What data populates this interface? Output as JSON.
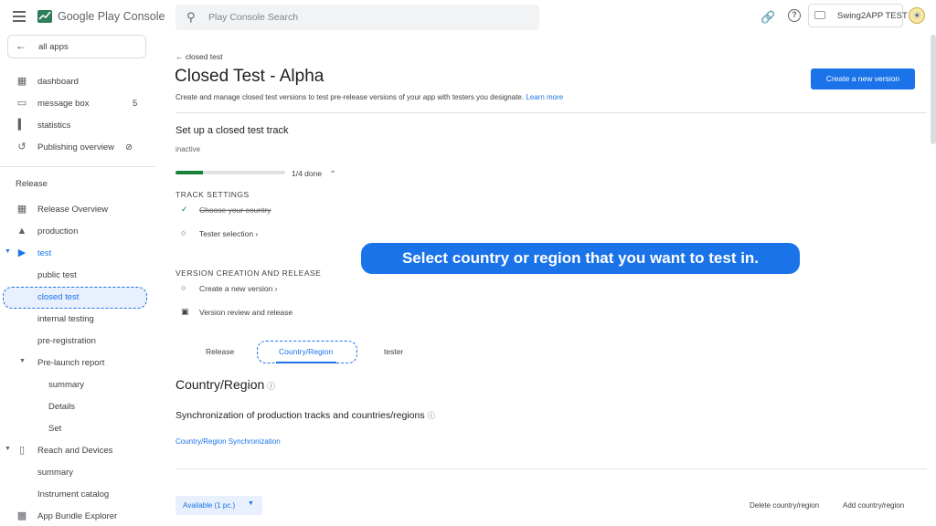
{
  "app": {
    "brand_prefix": "Google Play",
    "brand_suffix": "Console"
  },
  "search": {
    "placeholder": "Play Console Search"
  },
  "account": {
    "developer_name": "Swing2APP TEST"
  },
  "sidebar": {
    "all_apps_label": "all apps",
    "items": [
      {
        "label": "dashboard",
        "icon": "dashboard-icon"
      },
      {
        "label": "message box",
        "icon": "inbox-icon",
        "badge": "5"
      },
      {
        "label": "statistics",
        "icon": "bar-chart-icon"
      },
      {
        "label": "Publishing overview",
        "icon": "history-icon"
      }
    ],
    "release_section_label": "Release",
    "release_items": [
      {
        "label": "Release Overview",
        "icon": "grid-icon"
      },
      {
        "label": "production",
        "icon": "warning-icon"
      },
      {
        "label": "test",
        "icon": "play-icon"
      },
      {
        "label": "public test"
      },
      {
        "label": "closed test"
      },
      {
        "label": "internal testing"
      },
      {
        "label": "pre-registration"
      },
      {
        "label": "Pre-launch report"
      },
      {
        "label": "summary"
      },
      {
        "label": "Details"
      },
      {
        "label": "Set"
      },
      {
        "label": "Reach and Devices",
        "icon": "devices-icon"
      },
      {
        "label": "summary"
      },
      {
        "label": "Instrument catalog"
      },
      {
        "label": "App Bundle Explorer",
        "icon": "bundle-icon"
      }
    ]
  },
  "main": {
    "back_label": "closed test",
    "title": "Closed Test - Alpha",
    "description": "Create and manage closed test versions to test pre-release versions of your app with testers you designate.",
    "learn_more": "Learn more",
    "create_button": "Create a new version",
    "setup_title": "Set up a closed test track",
    "status": "inactive",
    "progress": {
      "fraction": 0.25,
      "text": "1/4 done"
    },
    "track_settings_label": "TRACK SETTINGS",
    "steps_track": [
      {
        "label": "Choose your country",
        "done": true
      },
      {
        "label": "Tester selection ›",
        "done": false
      }
    ],
    "version_label": "VERSION CREATION AND RELEASE",
    "steps_version": [
      {
        "label": "Create a new version ›",
        "done": false
      },
      {
        "label": "Version review and release",
        "done": false
      }
    ],
    "tabs": [
      {
        "label": "Release"
      },
      {
        "label": "Country/Region"
      },
      {
        "label": "tester"
      }
    ],
    "section_title": "Country/Region",
    "sync_title": "Synchronization of production tracks and countries/regions",
    "sync_link": "Country/Region Synchronization",
    "filter_chip": "Available (1 pc.)",
    "delete_action": "Delete country/region",
    "add_action": "Add country/region"
  },
  "tooltip": "Select country or region that you want to test in.",
  "colors": {
    "accent": "#1a73e8",
    "success": "#188038",
    "highlight_bg": "#e8f0fe"
  }
}
